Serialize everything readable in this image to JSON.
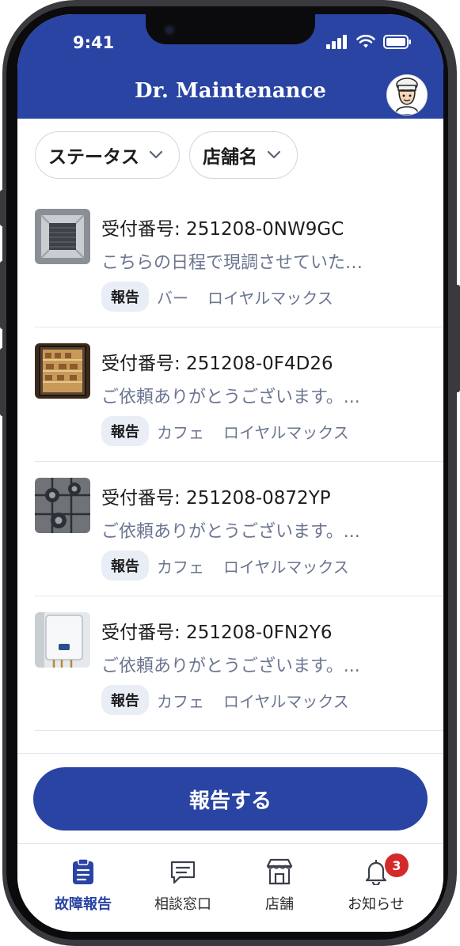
{
  "status_bar": {
    "time": "9:41"
  },
  "header": {
    "title": "Dr. Maintenance"
  },
  "filters": [
    {
      "label": "ステータス"
    },
    {
      "label": "店舗名"
    }
  ],
  "reports": [
    {
      "ticket": "受付番号: 251208-0NW9GC",
      "message": "こちらの日程で現調させていた…",
      "tag": "報告",
      "category": "バー",
      "store": "ロイヤルマックス",
      "thumb": "ceiling-ac"
    },
    {
      "ticket": "受付番号: 251208-0F4D26",
      "message": "ご依頼ありがとうございます。...",
      "tag": "報告",
      "category": "カフェ",
      "store": "ロイヤルマックス",
      "thumb": "display-fridge"
    },
    {
      "ticket": "受付番号: 251208-0872YP",
      "message": "ご依頼ありがとうございます。...",
      "tag": "報告",
      "category": "カフェ",
      "store": "ロイヤルマックス",
      "thumb": "gas-stove"
    },
    {
      "ticket": "受付番号: 251208-0FN2Y6",
      "message": "ご依頼ありがとうございます。...",
      "tag": "報告",
      "category": "カフェ",
      "store": "ロイヤルマックス",
      "thumb": "water-heater"
    }
  ],
  "report_button": {
    "label": "報告する"
  },
  "tabs": [
    {
      "label": "故障報告",
      "icon": "clipboard-icon",
      "active": true
    },
    {
      "label": "相談窓口",
      "icon": "chat-icon",
      "active": false
    },
    {
      "label": "店舗",
      "icon": "store-icon",
      "active": false
    },
    {
      "label": "お知らせ",
      "icon": "bell-icon",
      "active": false,
      "badge": "3"
    }
  ],
  "colors": {
    "brand": "#2a44a3",
    "badge": "#d42a2a",
    "muted_text": "#6b7590"
  }
}
